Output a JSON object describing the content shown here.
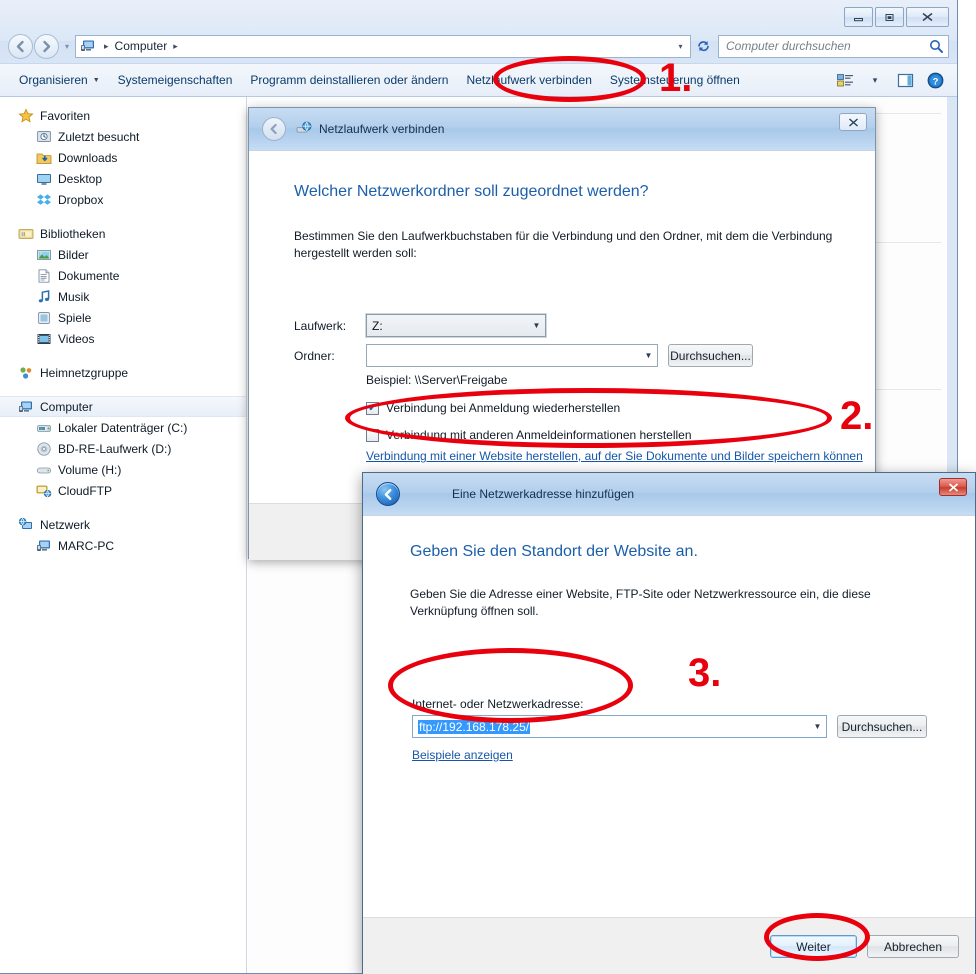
{
  "window": {
    "minimize_label": "Minimieren",
    "maximize_label": "Maximieren",
    "close_label": "Schließen"
  },
  "addressbar": {
    "crumb_root": "Computer",
    "separator": "▸"
  },
  "search": {
    "placeholder": "Computer durchsuchen"
  },
  "toolbar": {
    "items": [
      {
        "label": "Organisieren",
        "has_caret": true
      },
      {
        "label": "Systemeigenschaften",
        "has_caret": false
      },
      {
        "label": "Programm deinstallieren oder ändern",
        "has_caret": false
      },
      {
        "label": "Netzlaufwerk verbinden",
        "has_caret": false
      },
      {
        "label": "Systemsteuerung öffnen",
        "has_caret": false
      }
    ],
    "view_icon": "view-options-icon",
    "view_caret": "▾",
    "preview_icon": "preview-pane-icon",
    "help_icon": "help-icon"
  },
  "sidebar": {
    "groups": [
      {
        "header": {
          "label": "Favoriten",
          "icon": "star-icon"
        },
        "items": [
          {
            "label": "Zuletzt besucht",
            "icon": "recent-places-icon"
          },
          {
            "label": "Downloads",
            "icon": "downloads-icon"
          },
          {
            "label": "Desktop",
            "icon": "desktop-icon"
          },
          {
            "label": "Dropbox",
            "icon": "dropbox-icon"
          }
        ]
      },
      {
        "header": {
          "label": "Bibliotheken",
          "icon": "libraries-icon"
        },
        "items": [
          {
            "label": "Bilder",
            "icon": "pictures-icon"
          },
          {
            "label": "Dokumente",
            "icon": "documents-icon"
          },
          {
            "label": "Musik",
            "icon": "music-icon"
          },
          {
            "label": "Spiele",
            "icon": "games-icon"
          },
          {
            "label": "Videos",
            "icon": "videos-icon"
          }
        ]
      },
      {
        "header": {
          "label": "Heimnetzgruppe",
          "icon": "homegroup-icon"
        },
        "items": []
      },
      {
        "header": {
          "label": "Computer",
          "icon": "computer-icon",
          "selected": true
        },
        "items": [
          {
            "label": "Lokaler Datenträger (C:)",
            "icon": "harddisk-icon"
          },
          {
            "label": "BD-RE-Laufwerk (D:)",
            "icon": "optical-drive-icon"
          },
          {
            "label": "Volume (H:)",
            "icon": "removable-drive-icon"
          },
          {
            "label": "CloudFTP",
            "icon": "network-location-icon"
          }
        ]
      },
      {
        "header": {
          "label": "Netzwerk",
          "icon": "network-icon"
        },
        "items": [
          {
            "label": "MARC-PC",
            "icon": "computer-icon"
          }
        ]
      }
    ]
  },
  "dialog_map_drive": {
    "title": "Netzlaufwerk verbinden",
    "title_icon": "map-network-drive-icon",
    "back_label": "Zurück",
    "close_label": "Schließen",
    "heading": "Welcher Netzwerkordner soll zugeordnet werden?",
    "description": "Bestimmen Sie den Laufwerkbuchstaben für die Verbindung und den Ordner, mit dem die Verbindung hergestellt werden soll:",
    "drive_label": "Laufwerk:",
    "drive_value": "Z:",
    "folder_label": "Ordner:",
    "folder_value": "",
    "browse_label": "Durchsuchen...",
    "example_text": "Beispiel: \\\\Server\\Freigabe",
    "checkbox_reconnect": {
      "label": "Verbindung bei Anmeldung wiederherstellen",
      "checked": true,
      "mark": "✔"
    },
    "checkbox_credentials": {
      "label": "Verbindung mit anderen Anmeldeinformationen herstellen",
      "checked": false,
      "mark": ""
    },
    "link_website": "Verbindung mit einer Website herstellen, auf der Sie Dokumente und Bilder speichern können"
  },
  "dialog_add_address": {
    "title": "Eine Netzwerkadresse hinzufügen",
    "back_label": "Zurück",
    "close_label": "Schließen",
    "heading": "Geben Sie den Standort der Website an.",
    "description": "Geben Sie die Adresse einer Website, FTP-Site oder Netzwerkressource ein, die diese Verknüpfung öffnen soll.",
    "address_label": "Internet- oder Netzwerkadresse:",
    "address_value": "ftp://192.168.178.25/",
    "browse_label": "Durchsuchen...",
    "examples_link": "Beispiele anzeigen",
    "next_label": "Weiter",
    "cancel_label": "Abbrechen"
  },
  "annotations": {
    "color": "#e8000d",
    "markers": [
      {
        "number": "1.",
        "target": "Netzlaufwerk verbinden"
      },
      {
        "number": "2.",
        "target": "Verbindung mit einer Website herstellen"
      },
      {
        "number": "3.",
        "target": "Internet- oder Netzwerkadresse"
      }
    ]
  }
}
